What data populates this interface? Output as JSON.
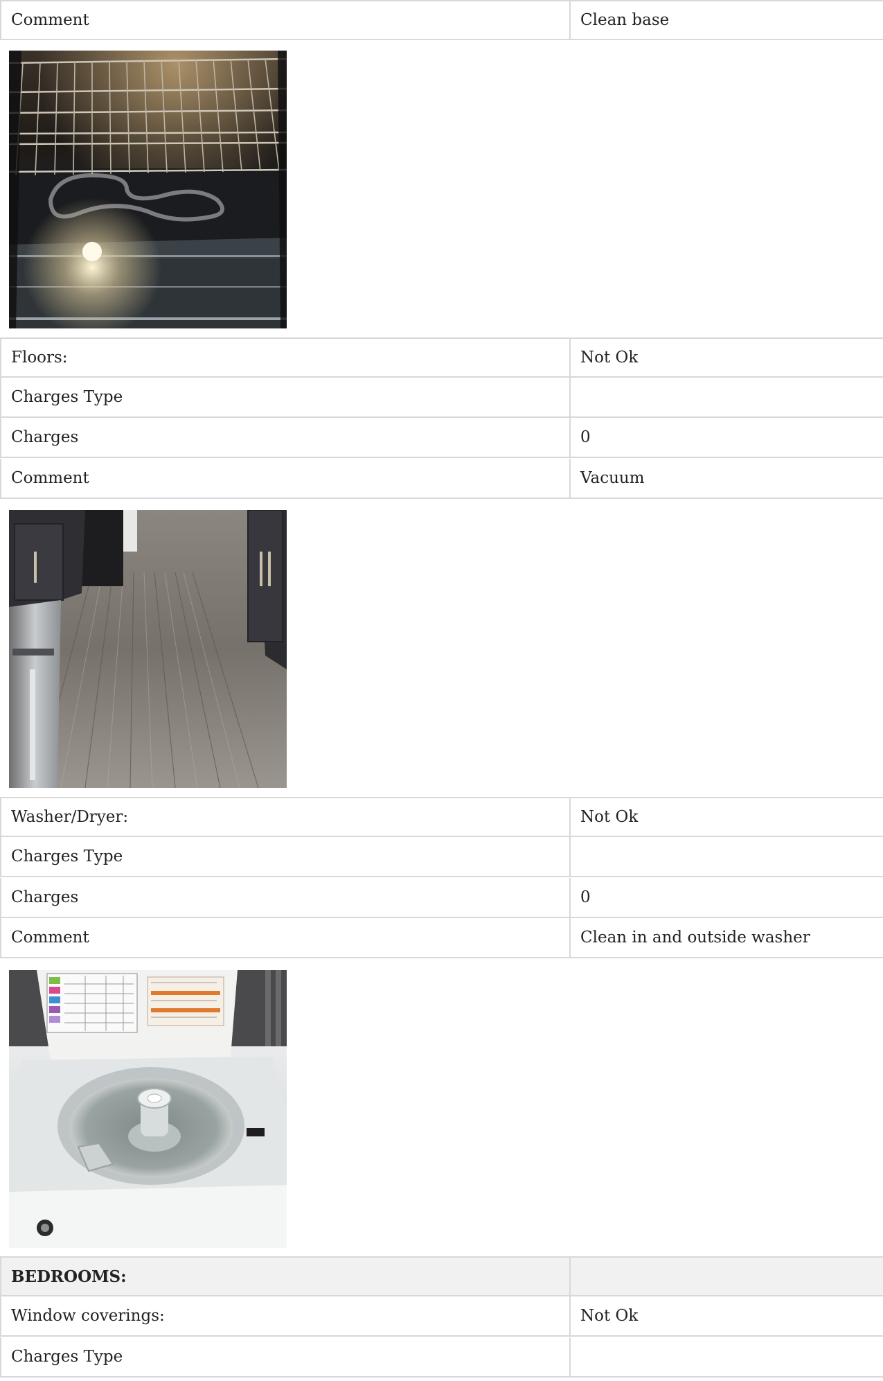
{
  "rows": [
    {
      "label": "Comment",
      "value": "Clean base"
    },
    {
      "label": "Floors:",
      "value": "Not Ok"
    },
    {
      "label": "Charges Type",
      "value": ""
    },
    {
      "label": "Charges",
      "value": "0"
    },
    {
      "label": "Comment",
      "value": "Vacuum"
    },
    {
      "label": "Washer/Dryer:",
      "value": "Not Ok"
    },
    {
      "label": "Charges Type",
      "value": ""
    },
    {
      "label": "Charges",
      "value": "0"
    },
    {
      "label": "Comment",
      "value": "Clean in and outside washer"
    },
    {
      "label": "BEDROOMS:",
      "value": ""
    },
    {
      "label": "Window coverings:",
      "value": "Not Ok"
    },
    {
      "label": "Charges Type",
      "value": ""
    }
  ],
  "photos": [
    {
      "subject": "oven-interior-photo"
    },
    {
      "subject": "kitchen-floor-photo"
    },
    {
      "subject": "washer-photo"
    }
  ],
  "colors": {
    "border": "#d8d8d8",
    "section_background": "#f1f1f1",
    "text": "#222222"
  }
}
